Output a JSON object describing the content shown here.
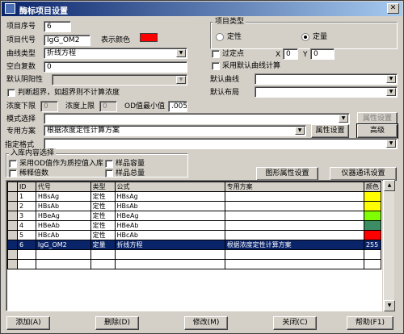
{
  "window": {
    "title": "酶标项目设置",
    "close_glyph": "✕"
  },
  "form": {
    "seq_label": "项目序号",
    "seq_value": "6",
    "code_label": "项目代号",
    "code_value": "IgG_OM2",
    "color_label": "表示颜色",
    "color_value": "#ff0000",
    "curve_type_label": "曲线类型",
    "curve_type_value": "折线方程",
    "blank_label": "空白复数",
    "blank_value": "0",
    "default_neg_label": "默认阴阳性",
    "default_neg_value": "",
    "out_of_range_label": "判断超界，如超界则不计算浓度",
    "conc_lower_label": "浓度下限",
    "conc_lower_value": "0",
    "conc_upper_label": "浓度上限",
    "conc_upper_value": "0",
    "od_min_label": "OD值最小值",
    "od_min_value": ".005",
    "mode_label": "模式选择",
    "mode_value": "",
    "special_label": "专用方案",
    "special_value": "根据浓度定性计算方案",
    "format_label": "指定格式",
    "format_value": ""
  },
  "project_type": {
    "title": "项目类型",
    "qualitative": "定性",
    "quantitative": "定量",
    "selected": "quantitative"
  },
  "right": {
    "pass_point_label": "过定点",
    "x_label": "X",
    "x_value": "0",
    "y_label": "Y",
    "y_value": "0",
    "use_default_curve_label": "采用默认曲线计算",
    "default_curve_label": "默认曲线",
    "default_curve_value": "",
    "default_layout_label": "默认布局",
    "default_layout_value": ""
  },
  "buttons": {
    "attr_settings": "属性设置",
    "attr_settings2": "属性设置",
    "advanced": "高级",
    "chart_settings": "图形属性设置",
    "instrument_settings": "仪器通讯设置",
    "add": "添加(A)",
    "delete": "删除(D)",
    "modify": "修改(M)",
    "close": "关闭(C)",
    "help": "帮助(F1)"
  },
  "storage": {
    "title": "入库内容选择",
    "use_od_label": "采用OD值作为质控值入库",
    "dilution_label": "稀释倍数",
    "sample_volume_label": "样品容量",
    "sample_total_label": "样品总量"
  },
  "table": {
    "columns": [
      "ID",
      "代号",
      "类型",
      "公式",
      "专用方案",
      "颜色"
    ],
    "rows": [
      {
        "id": "1",
        "code": "HBsAg",
        "type": "定性",
        "formula": "HBsAg",
        "scheme": "",
        "color": "#ffff00",
        "color_text": "",
        "selected": false
      },
      {
        "id": "2",
        "code": "HBsAb",
        "type": "定性",
        "formula": "HBsAb",
        "scheme": "",
        "color": "#ffff00",
        "color_text": "",
        "selected": false
      },
      {
        "id": "3",
        "code": "HBeAg",
        "type": "定性",
        "formula": "HBeAg",
        "scheme": "",
        "color": "#80ff00",
        "color_text": "",
        "selected": false
      },
      {
        "id": "4",
        "code": "HBeAb",
        "type": "定性",
        "formula": "HBeAb",
        "scheme": "",
        "color": "#3c8c64",
        "color_text": "",
        "selected": false
      },
      {
        "id": "5",
        "code": "HBcAb",
        "type": "定性",
        "formula": "HBcAb",
        "scheme": "",
        "color": "#ff0000",
        "color_text": "",
        "selected": false
      },
      {
        "id": "6",
        "code": "IgG_OM2",
        "type": "定量",
        "formula": "折线方程",
        "scheme": "根据浓度定性计算方案",
        "color": "",
        "color_text": "255",
        "selected": true
      }
    ]
  }
}
